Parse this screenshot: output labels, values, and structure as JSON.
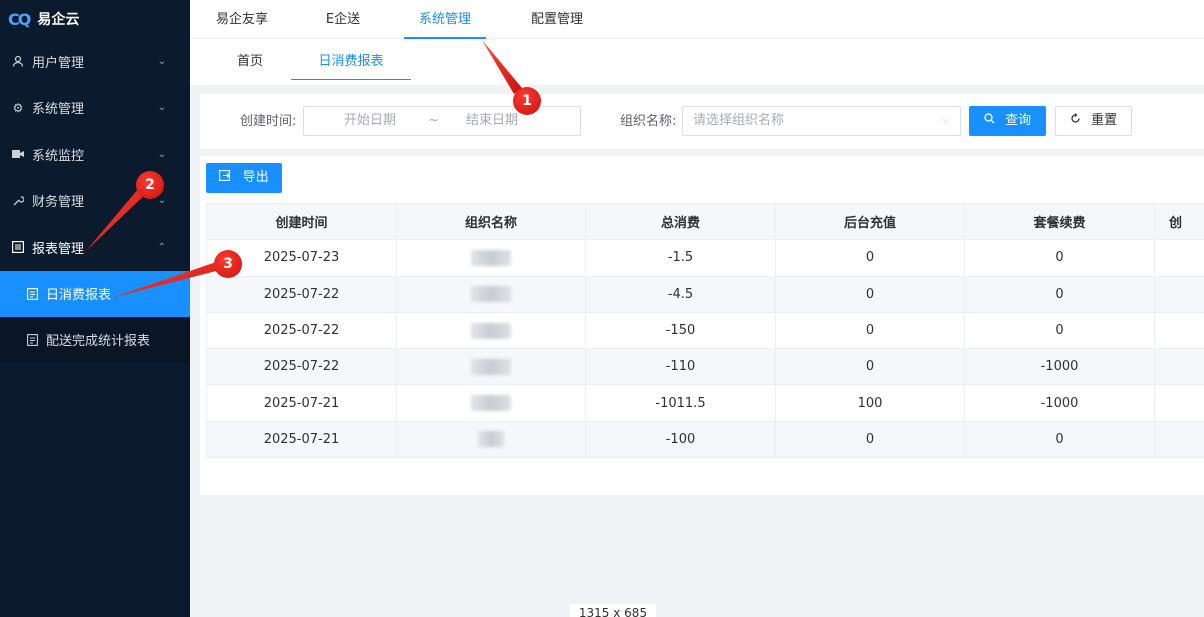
{
  "app": {
    "logo_text": "易企云",
    "logo_mark": "CQ"
  },
  "sidebar": {
    "items": [
      {
        "label": "用户管理",
        "icon": "user-icon"
      },
      {
        "label": "系统管理",
        "icon": "gear-icon"
      },
      {
        "label": "系统监控",
        "icon": "video-icon"
      },
      {
        "label": "财务管理",
        "icon": "wrench-icon"
      },
      {
        "label": "报表管理",
        "icon": "list-icon",
        "expanded": true
      }
    ],
    "submenu": [
      {
        "label": "日消费报表",
        "icon": "report-icon",
        "active": true
      },
      {
        "label": "配送完成统计报表",
        "icon": "report-icon"
      }
    ]
  },
  "topnav": {
    "tabs": [
      "易企友享",
      "E企送",
      "系统管理",
      "配置管理"
    ],
    "active": "系统管理"
  },
  "subtabs": {
    "tabs": [
      "首页",
      "日消费报表"
    ],
    "active": "日消费报表"
  },
  "filter": {
    "created_label": "创建时间:",
    "start_placeholder": "开始日期",
    "range_sep": "~",
    "end_placeholder": "结束日期",
    "org_label": "组织名称:",
    "org_placeholder": "请选择组织名称",
    "search_label": "查询",
    "reset_label": "重置"
  },
  "export_label": "导出",
  "table": {
    "headers": [
      "创建时间",
      "组织名称",
      "总消费",
      "后台充值",
      "套餐续费",
      "创"
    ],
    "rows": [
      {
        "date": "2025-07-23",
        "total": "-1.5",
        "recharge": "0",
        "renewal": "0"
      },
      {
        "date": "2025-07-22",
        "total": "-4.5",
        "recharge": "0",
        "renewal": "0"
      },
      {
        "date": "2025-07-22",
        "total": "-150",
        "recharge": "0",
        "renewal": "0"
      },
      {
        "date": "2025-07-22",
        "total": "-110",
        "recharge": "0",
        "renewal": "-1000"
      },
      {
        "date": "2025-07-21",
        "total": "-1011.5",
        "recharge": "100",
        "renewal": "-1000"
      },
      {
        "date": "2025-07-21",
        "total": "-100",
        "recharge": "0",
        "renewal": "0"
      }
    ]
  },
  "annotations": [
    "1",
    "2",
    "3"
  ],
  "screen_size_label": "1315 x 685",
  "colors": {
    "primary": "#1890ff",
    "sidebar_bg": "#0b1a2d",
    "annotation": "#e0201b"
  }
}
